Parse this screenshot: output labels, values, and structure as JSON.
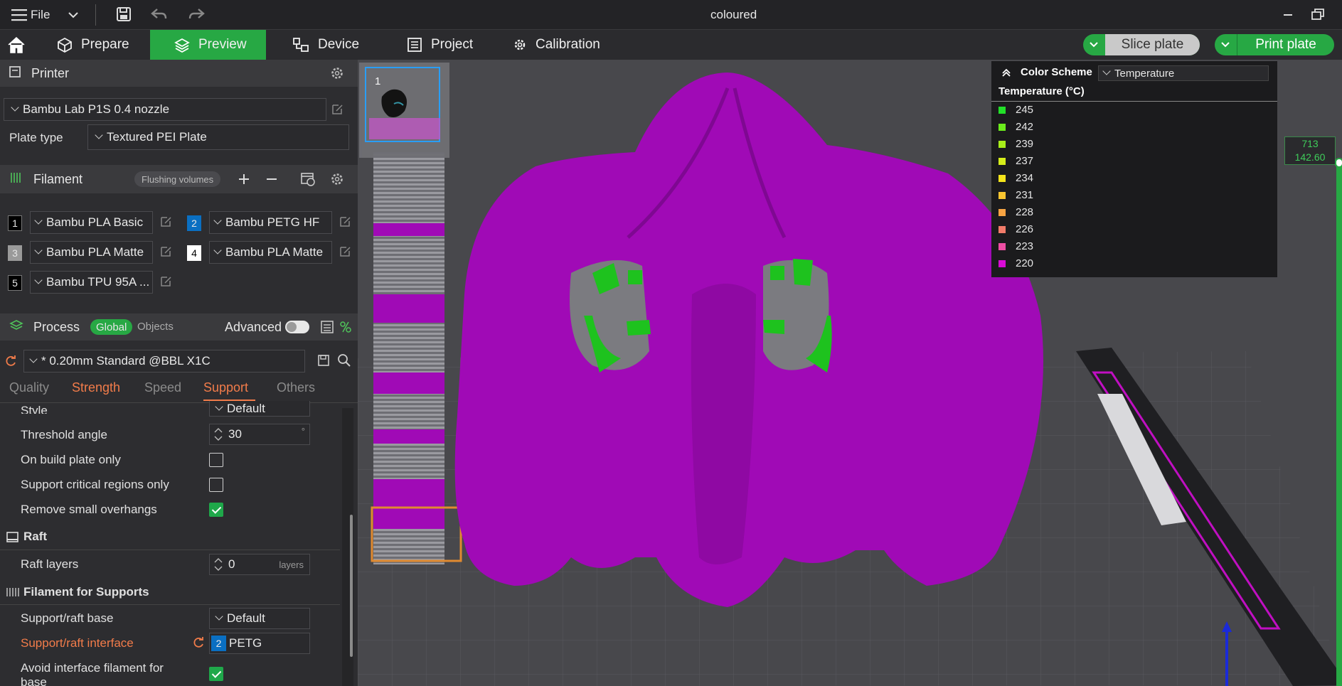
{
  "titlebar": {
    "menu_label": "File",
    "title": "coloured"
  },
  "tabs": [
    {
      "label": "Prepare"
    },
    {
      "label": "Preview"
    },
    {
      "label": "Device"
    },
    {
      "label": "Project"
    },
    {
      "label": "Calibration"
    }
  ],
  "actions": {
    "slice_label": "Slice plate",
    "print_label": "Print plate"
  },
  "printer": {
    "section_title": "Printer",
    "selected": "Bambu Lab P1S 0.4 nozzle",
    "plate_type_label": "Plate type",
    "plate_type_value": "Textured PEI Plate"
  },
  "filament": {
    "section_title": "Filament",
    "flushing_label": "Flushing volumes",
    "items": [
      {
        "num": "1",
        "name": "Bambu PLA Basic",
        "color": "#000000"
      },
      {
        "num": "2",
        "name": "Bambu PETG HF",
        "color": "#0a6fc2"
      },
      {
        "num": "3",
        "name": "Bambu PLA Matte",
        "color": "#9a9a9a"
      },
      {
        "num": "4",
        "name": "Bambu PLA Matte",
        "color": "#ffffff"
      },
      {
        "num": "5",
        "name": "Bambu TPU 95A ...",
        "color": "#000000"
      }
    ]
  },
  "process": {
    "section_title": "Process",
    "global_label": "Global",
    "objects_label": "Objects",
    "advanced_label": "Advanced",
    "preset": "* 0.20mm Standard @BBL X1C",
    "subtabs": [
      "Quality",
      "Strength",
      "Speed",
      "Support",
      "Others"
    ]
  },
  "settings": {
    "style_label": "Style",
    "style_value": "Default",
    "threshold_label": "Threshold angle",
    "threshold_value": "30",
    "threshold_unit": "°",
    "build_plate_only_label": "On build plate only",
    "critical_regions_label": "Support critical regions only",
    "remove_overhangs_label": "Remove small overhangs",
    "raft_title": "Raft",
    "raft_layers_label": "Raft layers",
    "raft_layers_value": "0",
    "raft_layers_unit": "layers",
    "filament_supports_title": "Filament for Supports",
    "raft_base_label": "Support/raft base",
    "raft_base_value": "Default",
    "raft_interface_label": "Support/raft interface",
    "raft_interface_num": "2",
    "raft_interface_value": "PETG",
    "avoid_interface_label_1": "Avoid interface filament for",
    "avoid_interface_label_2": "base"
  },
  "thumbnail": {
    "number": "1"
  },
  "legend": {
    "header": "Color Scheme",
    "scheme": "Temperature",
    "title": "Temperature (°C)",
    "entries": [
      {
        "value": "245",
        "color": "#22e028"
      },
      {
        "value": "242",
        "color": "#6bec1c"
      },
      {
        "value": "239",
        "color": "#a8ee1a"
      },
      {
        "value": "237",
        "color": "#d6ee1a"
      },
      {
        "value": "234",
        "color": "#f4e41b"
      },
      {
        "value": "231",
        "color": "#f8c530"
      },
      {
        "value": "228",
        "color": "#f7a443"
      },
      {
        "value": "226",
        "color": "#f27c6a"
      },
      {
        "value": "223",
        "color": "#ee4ea4"
      },
      {
        "value": "220",
        "color": "#d90bd6"
      }
    ]
  },
  "layer_readout": {
    "layer": "713",
    "height": "142.60"
  },
  "colors": {
    "accent": "#27a844",
    "model": "#a00ab6",
    "support": "#1ec21e",
    "warn": "#f27c4a"
  }
}
